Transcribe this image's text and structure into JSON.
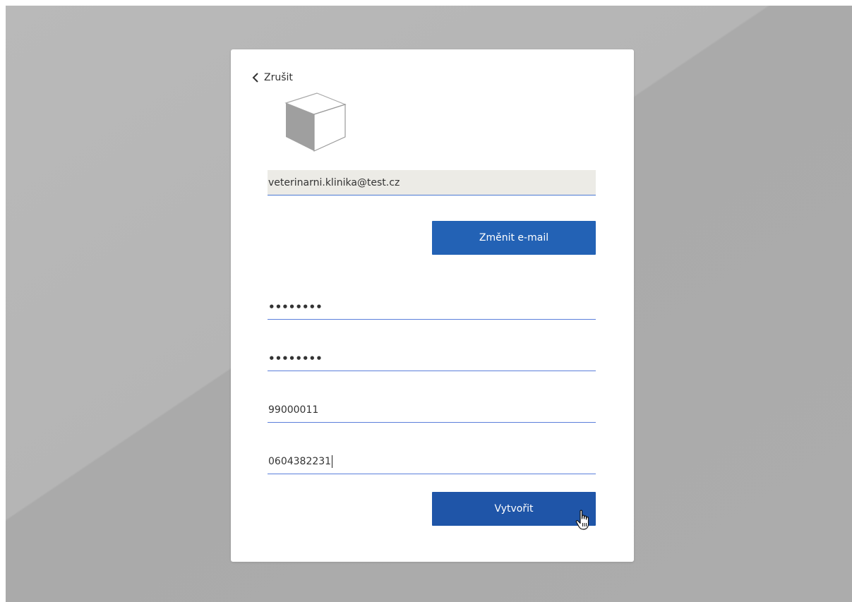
{
  "dialog": {
    "cancel_label": "Zrušit",
    "email_value": "veterinarni.klinika@test.cz",
    "change_email_label": "Změnit e-mail",
    "password_mask": "••••••••",
    "confirm_password_mask": "••••••••",
    "id_value": "99000011",
    "phone_value": "0604382231",
    "create_label": "Vytvořit"
  },
  "icons": {
    "back": "chevron-left-icon",
    "logo": "cube-logo-icon",
    "pointer": "hand-pointer-icon"
  },
  "colors": {
    "button": "#2362b5",
    "button_primary": "#1f55a8",
    "underline": "#5b7fdb",
    "readonly_bg": "#ecebe6",
    "backdrop": "#b3b3b3"
  }
}
